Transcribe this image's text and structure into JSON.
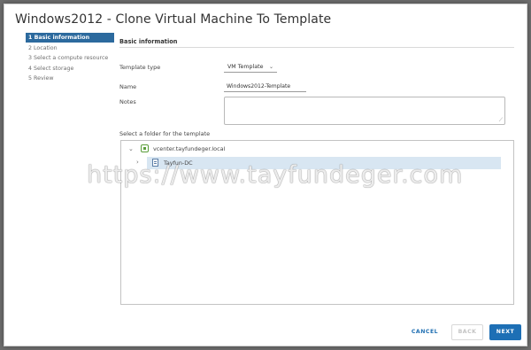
{
  "window": {
    "title": "Windows2012 - Clone Virtual Machine To Template"
  },
  "steps": [
    {
      "label": "1 Basic information",
      "active": true
    },
    {
      "label": "2 Location",
      "active": false
    },
    {
      "label": "3 Select a compute resource",
      "active": false
    },
    {
      "label": "4 Select storage",
      "active": false
    },
    {
      "label": "5 Review",
      "active": false
    }
  ],
  "form": {
    "section_title": "Basic information",
    "template_type_label": "Template type",
    "template_type_value": "VM Template",
    "name_label": "Name",
    "name_value": "Windows2012-Template",
    "notes_label": "Notes",
    "notes_value": "",
    "folder_label": "Select a folder for the template"
  },
  "tree": {
    "root": {
      "label": "vcenter.tayfundeger.local",
      "icon": "vcenter-icon",
      "expanded": true
    },
    "child": {
      "label": "Tayfun-DC",
      "icon": "datacenter-icon",
      "selected": true,
      "expanded": false
    }
  },
  "footer": {
    "cancel_label": "CANCEL",
    "back_label": "BACK",
    "next_label": "NEXT"
  },
  "watermark": {
    "text": "https://www.tayfundeger.com"
  },
  "colors": {
    "accent": "#1d6fb5",
    "active_step": "#2c6a9e",
    "selected_row": "#d8e6f2"
  }
}
